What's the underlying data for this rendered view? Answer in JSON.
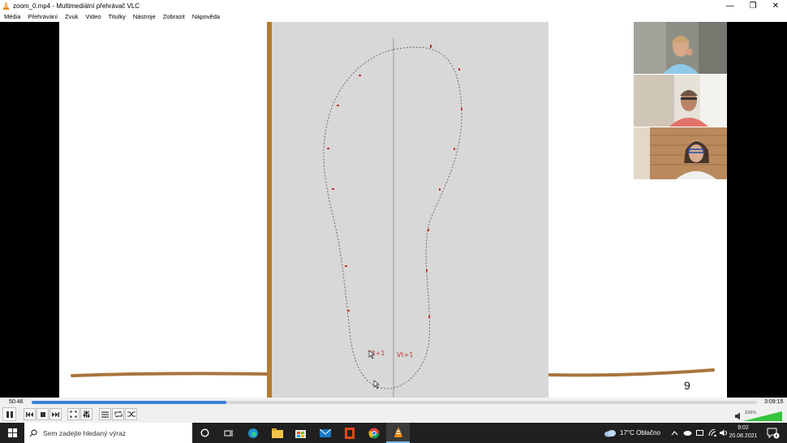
{
  "window": {
    "title": "zoom_0.mp4 - Multimediální přehrávač VLC",
    "minimize": "—",
    "restore": "❐",
    "close": "✕"
  },
  "menu": [
    "Média",
    "Přehrávání",
    "Zvuk",
    "Video",
    "Titulky",
    "Nástroje",
    "Zobrazit",
    "Nápověda"
  ],
  "video": {
    "slide_number": "9",
    "annotations": [
      "Vt+1",
      "Vt+1"
    ],
    "participants": [
      "participant-1",
      "participant-2",
      "participant-3"
    ]
  },
  "player": {
    "elapsed": "50:46",
    "total": "3:09:15",
    "progress": 0.268,
    "volume_label": "100%",
    "volume": 1.0,
    "accent": "#3b83d9"
  },
  "taskbar": {
    "search_placeholder": "Sem zadejte hledaný výraz",
    "weather": "17°C  Oblačno",
    "time": "9:02",
    "date": "20.08.2021",
    "notification_count": "4"
  }
}
